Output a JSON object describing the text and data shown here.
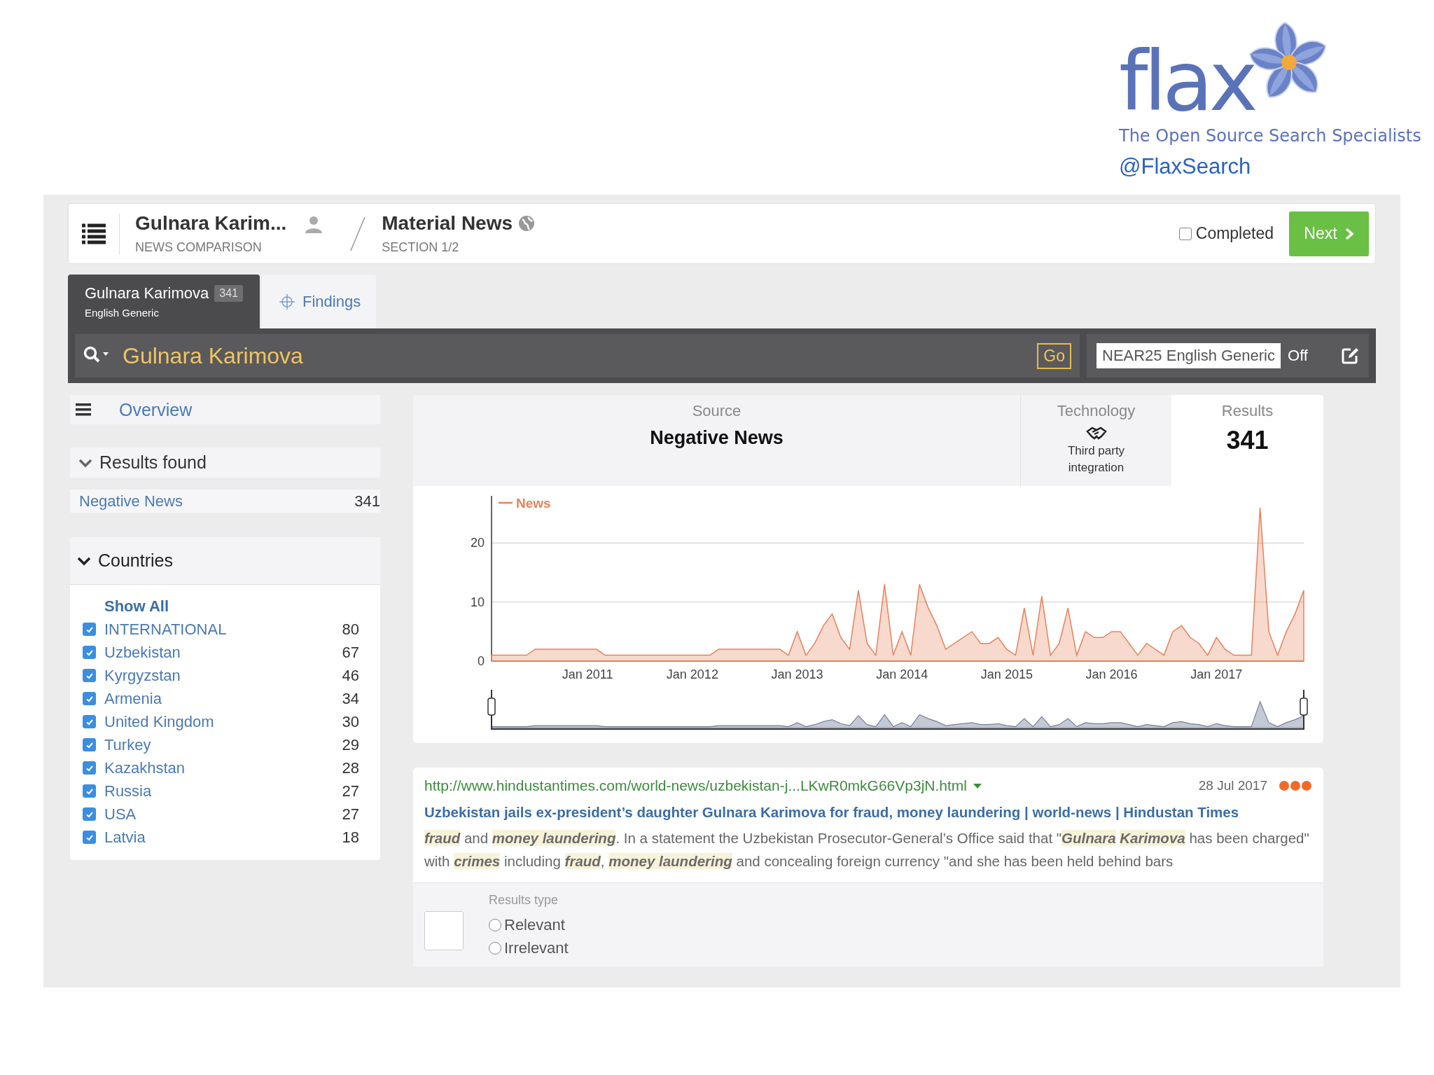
{
  "logo": {
    "wordmark": "flax",
    "tagline": "The Open Source Search Specialists",
    "handle": "@FlaxSearch"
  },
  "header": {
    "title": "Gulnara Karim...",
    "subtitle": "NEWS COMPARISON",
    "section_title": "Material News",
    "section_subtitle": "SECTION 1/2",
    "completed": {
      "label": "Completed",
      "checked": false
    },
    "next_button": "Next"
  },
  "tabs": [
    {
      "label": "Gulnara Karimova",
      "count": "341",
      "sublabel": "English Generic",
      "selected": true
    },
    {
      "label": "Findings",
      "selected": false
    }
  ],
  "search": {
    "query": "Gulnara Karimova",
    "go_button": "Go",
    "profile": "NEAR25 English Generic",
    "toggle": "Off"
  },
  "sidebar": {
    "overview": "Overview",
    "results_found": {
      "title": "Results found",
      "expanded": true,
      "items": [
        {
          "label": "Negative News",
          "count": "341"
        }
      ]
    },
    "countries": {
      "title": "Countries",
      "expanded": true,
      "show_all": "Show All",
      "items": [
        {
          "label": "INTERNATIONAL",
          "count": "80",
          "checked": true
        },
        {
          "label": "Uzbekistan",
          "count": "67",
          "checked": true
        },
        {
          "label": "Kyrgyzstan",
          "count": "46",
          "checked": true
        },
        {
          "label": "Armenia",
          "count": "34",
          "checked": true
        },
        {
          "label": "United Kingdom",
          "count": "30",
          "checked": true
        },
        {
          "label": "Turkey",
          "count": "29",
          "checked": true
        },
        {
          "label": "Kazakhstan",
          "count": "28",
          "checked": true
        },
        {
          "label": "Russia",
          "count": "27",
          "checked": true
        },
        {
          "label": "USA",
          "count": "27",
          "checked": true
        },
        {
          "label": "Latvia",
          "count": "18",
          "checked": true
        }
      ]
    }
  },
  "summary": {
    "source_label": "Source",
    "source": "Negative News",
    "technology_label": "Technology",
    "technology": "Third party integration",
    "results_label": "Results",
    "results": "341",
    "chart_data": {
      "type": "area",
      "categories": [
        null,
        null,
        null,
        null,
        null,
        null,
        null,
        null,
        null,
        null,
        null,
        "Jan 2011",
        null,
        null,
        null,
        null,
        null,
        null,
        null,
        null,
        null,
        null,
        null,
        "Jan 2012",
        null,
        null,
        null,
        null,
        null,
        null,
        null,
        null,
        null,
        null,
        null,
        "Jan 2013",
        null,
        null,
        null,
        null,
        null,
        null,
        null,
        null,
        null,
        null,
        null,
        "Jan 2014",
        null,
        null,
        null,
        null,
        null,
        null,
        null,
        null,
        null,
        null,
        null,
        "Jan 2015",
        null,
        null,
        null,
        null,
        null,
        null,
        null,
        null,
        null,
        null,
        null,
        "Jan 2016",
        null,
        null,
        null,
        null,
        null,
        null,
        null,
        null,
        null,
        null,
        null,
        "Jan 2017",
        null,
        null,
        null,
        null,
        null,
        null,
        null,
        null,
        null,
        null
      ],
      "series": [
        {
          "name": "News",
          "color": "#e8825a",
          "values": [
            1,
            1,
            1,
            1,
            1,
            2,
            2,
            2,
            2,
            2,
            2,
            2,
            2,
            1,
            1,
            1,
            1,
            1,
            1,
            1,
            1,
            1,
            1,
            1,
            1,
            1,
            2,
            2,
            2,
            2,
            2,
            2,
            2,
            2,
            1,
            5,
            1,
            3,
            6,
            8,
            4,
            2,
            12,
            3,
            1,
            13,
            1,
            5,
            1,
            13,
            9,
            6,
            2,
            3,
            4,
            5,
            3,
            3,
            4,
            2,
            1,
            9,
            1,
            11,
            1,
            3,
            9,
            1,
            5,
            4,
            4,
            5,
            5,
            3,
            1,
            3,
            2,
            1,
            5,
            6,
            4,
            3,
            1,
            4,
            2,
            1,
            1,
            1,
            26,
            5,
            1,
            5,
            8,
            12
          ]
        }
      ],
      "ylim": [
        0,
        28
      ],
      "yticks": [
        0,
        10,
        20
      ]
    }
  },
  "results": [
    {
      "url": "http://www.hindustantimes.com/world-news/uzbekistan-j...LKwR0mkG66Vp3jN.html",
      "date": "28 Jul 2017",
      "title": "Uzbekistan jails ex-president’s daughter Gulnara Karimova for fraud, money laundering | world-news | Hindustan Times",
      "snippet": "**fraud** and **money laundering**. In a statement the Uzbekistan Prosecutor-General’s Office said that \"**Gulnara** **Karimova** has been charged\" with **crimes** including **fraud**, **money laundering** and concealing foreign currency \"and she has been held behind bars",
      "results_type_label": "Results type",
      "options": [
        {
          "label": "Relevant",
          "selected": false
        },
        {
          "label": "Irrelevant",
          "selected": false
        }
      ]
    }
  ]
}
